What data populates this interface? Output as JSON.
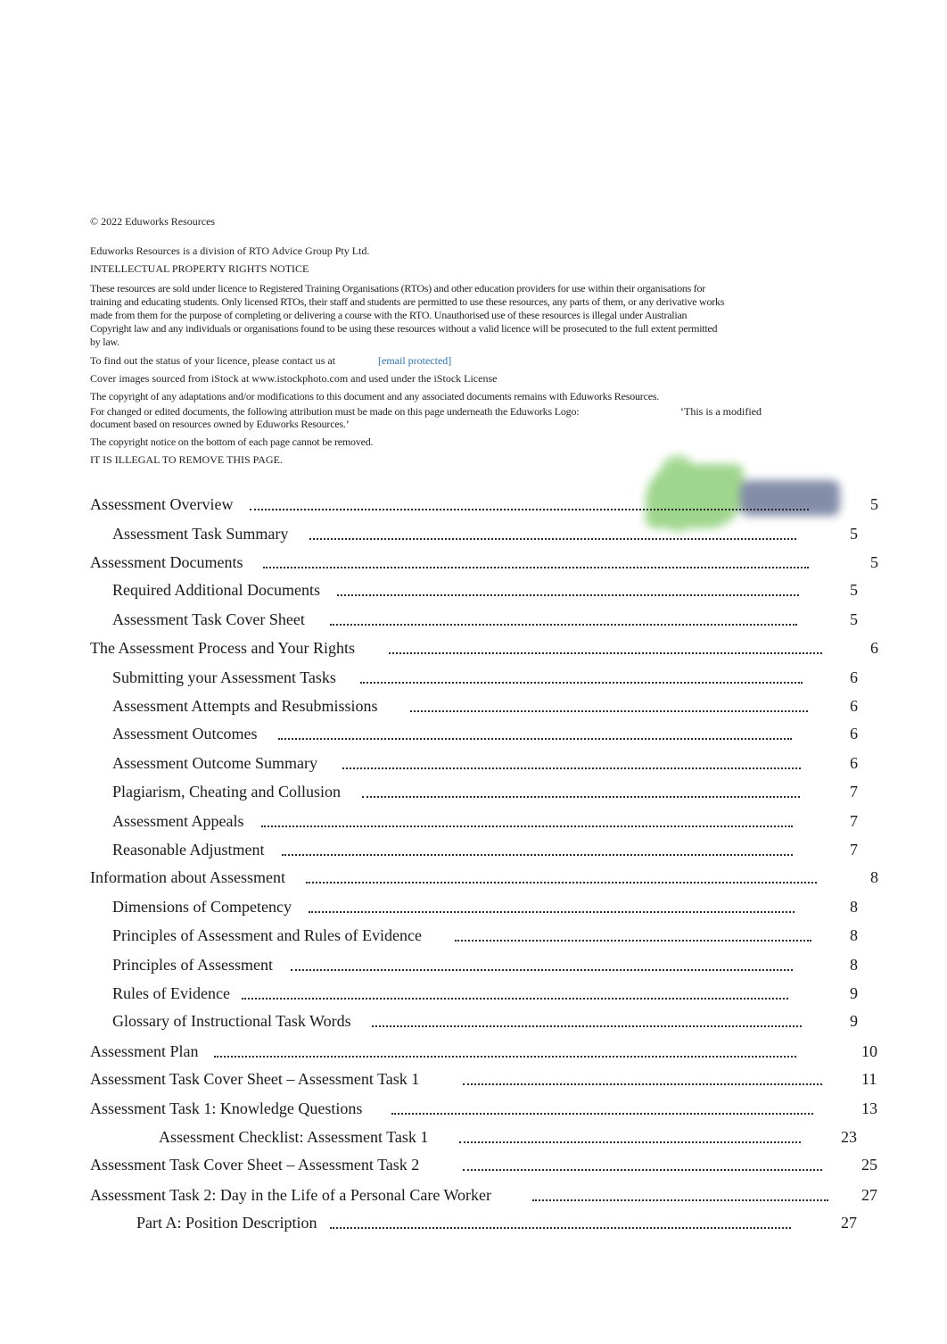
{
  "copyright_line": "© 2022 Eduworks Resources",
  "division_line": "Eduworks Resources is a division of RTO Advice Group Pty Ltd.",
  "ip_heading": "INTELLECTUAL PROPERTY RIGHTS NOTICE",
  "licence_paragraph": "These resources are sold under licence to Registered Training Organisations (RTOs) and other education providers for use within their organisations for training and educating students. Only licensed RTOs, their staff and students are permitted to use these resources, any parts of them, or any derivative works made from them for the purpose of completing or delivering a course with the RTO. Unauthorised use of these resources is illegal under Australian Copyright law and any individuals or organisations found to be using these resources without a valid licence will be prosecuted to the full extent permitted by law.",
  "licence_status_text": "To find out the status of your licence, please contact us at",
  "contact_email": "[email protected]",
  "cover_images_line": "Cover images sourced from iStock at www.istockphoto.com and used under the iStock License",
  "adaptations_line": "The copyright of any adaptations and/or modifications to this document and any associated documents remains with Eduworks Resources.",
  "attribution_line": "For changed or edited documents, the following attribution must be made on this page underneath the Eduworks Logo:",
  "attribution_quote": "‘This is a modified",
  "attribution_quote_cont": "document based on resources owned by Eduworks Resources.’",
  "bottom_notice_line": "The copyright notice on the bottom of each page cannot be removed.",
  "illegal_line": "IT IS ILLEGAL TO REMOVE THIS PAGE.",
  "logo": {
    "name": "Eduworks logo",
    "colors": {
      "green": "#8fcf7a",
      "navy": "#6e7a9a"
    }
  },
  "link_color": "#2e74b5",
  "toc": [
    {
      "label": "Assessment Overview",
      "page": "5",
      "level": 1
    },
    {
      "label": "Assessment Task Summary",
      "page": "5",
      "level": 2
    },
    {
      "label": "Assessment Documents",
      "page": "5",
      "level": 1
    },
    {
      "label": "Required Additional Documents",
      "page": "5",
      "level": 2
    },
    {
      "label": "Assessment Task Cover Sheet",
      "page": "5",
      "level": 2
    },
    {
      "label": "The Assessment Process and Your Rights",
      "page": "6",
      "level": 1
    },
    {
      "label": "Submitting your Assessment Tasks",
      "page": "6",
      "level": 2
    },
    {
      "label": "Assessment Attempts and Resubmissions",
      "page": "6",
      "level": 2
    },
    {
      "label": "Assessment Outcomes",
      "page": "6",
      "level": 2
    },
    {
      "label": "Assessment Outcome Summary",
      "page": "6",
      "level": 2
    },
    {
      "label": "Plagiarism, Cheating and Collusion",
      "page": "7",
      "level": 2
    },
    {
      "label": "Assessment Appeals",
      "page": "7",
      "level": 2
    },
    {
      "label": "Reasonable Adjustment",
      "page": "7",
      "level": 2
    },
    {
      "label": "Information about Assessment",
      "page": "8",
      "level": 1
    },
    {
      "label": "Dimensions of Competency",
      "page": "8",
      "level": 2
    },
    {
      "label": "Principles of Assessment and Rules of Evidence",
      "page": "8",
      "level": 2
    },
    {
      "label": "Principles of Assessment",
      "page": "8",
      "level": 2
    },
    {
      "label": "Rules of Evidence",
      "page": "9",
      "level": 2
    },
    {
      "label": "Glossary of Instructional Task Words",
      "page": "9",
      "level": 2
    },
    {
      "label": "Assessment Plan",
      "page": "10",
      "level": 1
    },
    {
      "label": "Assessment Task Cover Sheet – Assessment Task 1",
      "page": "11",
      "level": 1
    },
    {
      "label": "Assessment Task 1: Knowledge Questions",
      "page": "13",
      "level": 1
    },
    {
      "label": "Assessment Checklist: Assessment Task 1",
      "page": "23",
      "level": 3
    },
    {
      "label": "Assessment Task Cover Sheet – Assessment Task 2",
      "page": "25",
      "level": 1
    },
    {
      "label": "Assessment Task 2: Day in the Life of a Personal Care Worker",
      "page": "27",
      "level": 1
    },
    {
      "label": "Part A: Position Description",
      "page": "27",
      "level": 2
    }
  ]
}
